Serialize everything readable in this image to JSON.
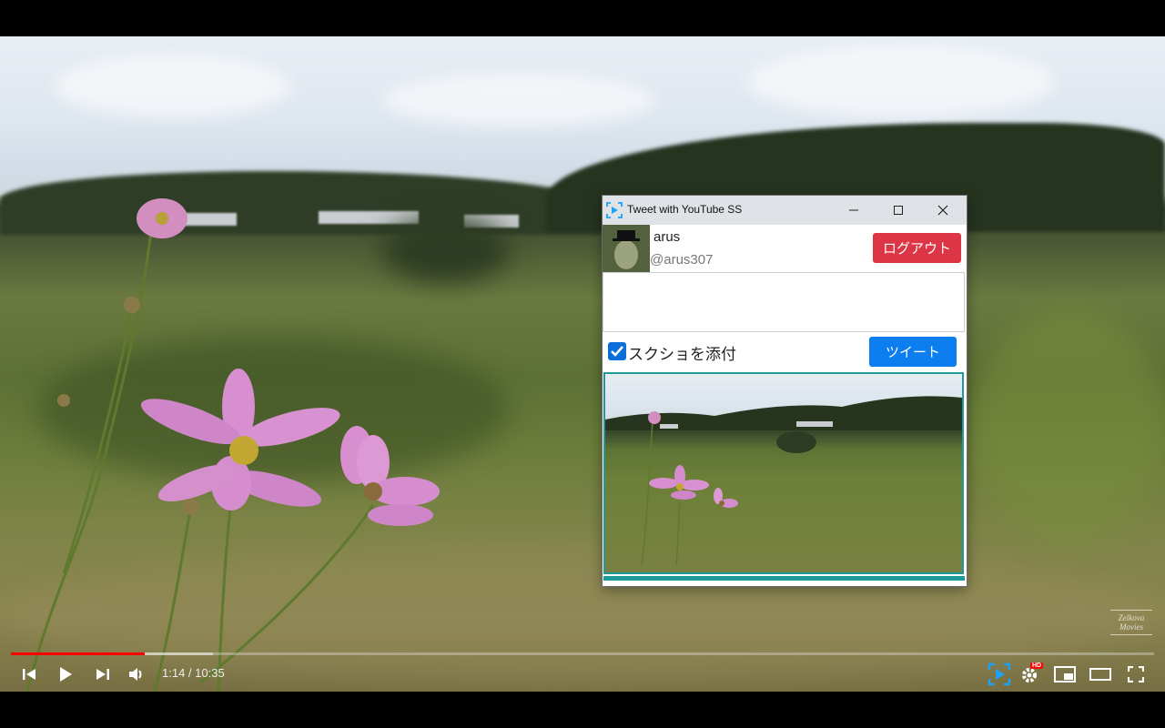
{
  "player": {
    "current_time": "1:14",
    "duration": "10:35",
    "time_display": "1:14 / 10:35",
    "played_fraction": 0.117,
    "loaded_fraction": 0.177,
    "watermark_line1": "Zelkova",
    "watermark_line2": "Movies",
    "hd_badge": "HD",
    "icons": [
      "skip-previous-icon",
      "play-icon",
      "skip-next-icon",
      "volume-icon",
      "tweet-extension-icon",
      "settings-icon",
      "miniplayer-icon",
      "theater-mode-icon",
      "fullscreen-icon"
    ]
  },
  "popup": {
    "title": "Tweet with YouTube SS",
    "user": {
      "name": "arus",
      "handle": "@arus307"
    },
    "logout_label": "ログアウト",
    "tweet_text": "",
    "attach_label": "スクショを添付",
    "attach_checked": true,
    "tweet_label": "ツイート",
    "colors": {
      "logout": "#dc3545",
      "tweet": "#0d7ef0",
      "preview_border": "#1f9a9a",
      "progress_played": "#ff0000"
    }
  }
}
